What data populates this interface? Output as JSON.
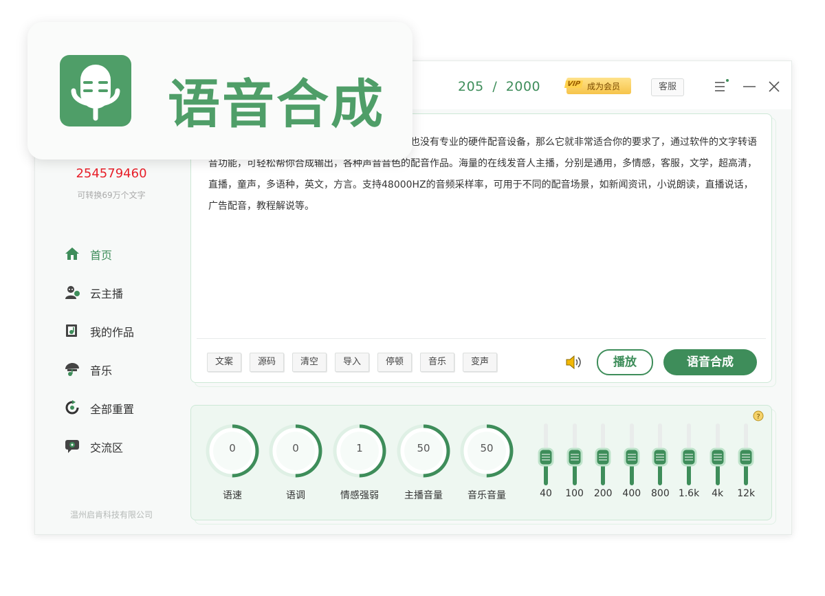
{
  "app": {
    "title": "语音合成"
  },
  "header": {
    "count": "205",
    "sep": "/",
    "max": "2000",
    "vip_tag": "VIP",
    "vip_label": "成为会员",
    "kefu": "客服"
  },
  "user": {
    "id": "254579460",
    "sub": "可转换69万个文字"
  },
  "sidebar": {
    "items": [
      {
        "label": "首页",
        "icon": "home-icon",
        "active": true
      },
      {
        "label": "云主播",
        "icon": "anchor-icon"
      },
      {
        "label": "我的作品",
        "icon": "works-icon"
      },
      {
        "label": "音乐",
        "icon": "music-icon"
      },
      {
        "label": "全部重置",
        "icon": "reset-icon"
      },
      {
        "label": "交流区",
        "icon": "chat-icon"
      }
    ],
    "company": "温州启肯科技有限公司"
  },
  "editor": {
    "text": "的文字转语音软件。如果你没有专业的配音能力也没有专业的硬件配音设备，那么它就非常适合你的要求了，通过软件的文字转语音功能，可轻松帮你合成输出，各种声音音色的配音作品。海量的在线发音人主播，分别是通用，多情感，客服，文学，超高清，直播，童声，多语种，英文，方言。支持48000HZ的音频采样率，可用于不同的配音场景，如新闻资讯，小说朗读，直播说话，广告配音，教程解说等。",
    "tools": [
      "文案",
      "源码",
      "清空",
      "导入",
      "停顿",
      "音乐",
      "变声"
    ],
    "play": "播放",
    "synth": "语音合成"
  },
  "params": {
    "dials": [
      {
        "label": "语速",
        "value": "0",
        "level": 0.5
      },
      {
        "label": "语调",
        "value": "0",
        "level": 0.5
      },
      {
        "label": "情感强弱",
        "value": "1",
        "level": 0.5
      },
      {
        "label": "主播音量",
        "value": "50",
        "level": 0.5
      },
      {
        "label": "音乐音量",
        "value": "50",
        "level": 0.5
      }
    ],
    "eq": [
      {
        "label": "40",
        "level": 0.5
      },
      {
        "label": "100",
        "level": 0.5
      },
      {
        "label": "200",
        "level": 0.5
      },
      {
        "label": "400",
        "level": 0.5
      },
      {
        "label": "800",
        "level": 0.5
      },
      {
        "label": "1.6k",
        "level": 0.5
      },
      {
        "label": "4k",
        "level": 0.5
      },
      {
        "label": "12k",
        "level": 0.5
      }
    ]
  },
  "colors": {
    "accent": "#3e8d5a",
    "accent_light": "#e5f2ea",
    "id_red": "#e8202a"
  }
}
